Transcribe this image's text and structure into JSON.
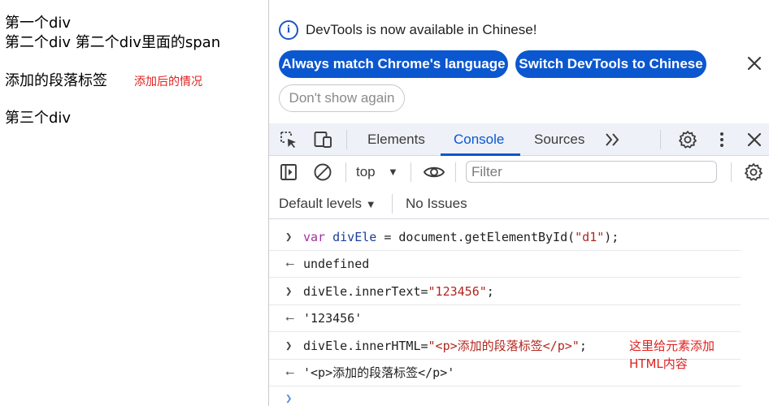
{
  "page": {
    "lines": [
      "第一个div",
      "第二个div 第二个div里面的span",
      "添加的段落标签",
      "第三个div"
    ],
    "annotation": "添加后的情况"
  },
  "devtools": {
    "banner": {
      "text": "DevTools is now available in Chinese!",
      "btn_match": "Always match Chrome's language",
      "btn_switch": "Switch DevTools to Chinese",
      "btn_dont": "Don't show again"
    },
    "tabs": [
      "Elements",
      "Console",
      "Sources"
    ],
    "active_tab": "Console",
    "toolbar": {
      "context": "top",
      "filter_placeholder": "Filter",
      "levels": "Default levels",
      "issues": "No Issues"
    },
    "console": {
      "rows": [
        {
          "kind": "input",
          "parts": {
            "kw": "var",
            "var": "divEle",
            "mid": " = document.getElementById(",
            "str": "\"d1\"",
            "end": ");"
          }
        },
        {
          "kind": "output",
          "text": "undefined"
        },
        {
          "kind": "input",
          "parts": {
            "pre": "divEle.innerText=",
            "str": "\"123456\"",
            "end": ";"
          }
        },
        {
          "kind": "output",
          "text": "'123456'"
        },
        {
          "kind": "input",
          "parts": {
            "pre": "divEle.innerHTML=",
            "str": "\"<p>添加的段落标签</p>\"",
            "end": ";"
          }
        },
        {
          "kind": "output",
          "text": "'<p>添加的段落标签</p>'"
        }
      ],
      "annotation_line1": "这里给元素添加",
      "annotation_line2": "HTML内容"
    }
  },
  "colors": {
    "accent": "#0b57d0",
    "annotation_red": "#e02020",
    "tabbar_bg": "#eef1f7"
  },
  "icons": [
    "info-icon",
    "close-icon",
    "inspect-element-icon",
    "device-toggle-icon",
    "more-tabs-icon",
    "settings-gear-icon",
    "kebab-menu-icon",
    "devtools-close-icon",
    "sidebar-toggle-icon",
    "clear-console-icon",
    "dropdown-caret-icon",
    "live-expression-eye-icon",
    "console-settings-gear-icon",
    "prompt-chevron-icon"
  ]
}
